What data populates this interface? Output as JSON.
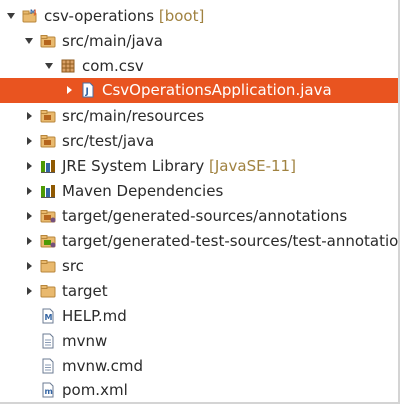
{
  "tree": {
    "project": {
      "label": "csv-operations",
      "decoration": "[boot]",
      "expanded": true
    },
    "src_main_java": {
      "label": "src/main/java",
      "expanded": true
    },
    "package_com_csv": {
      "label": "com.csv",
      "expanded": true
    },
    "main_class": {
      "label": "CsvOperationsApplication.java",
      "selected": true
    },
    "src_main_resources": {
      "label": "src/main/resources"
    },
    "src_test_java": {
      "label": "src/test/java"
    },
    "jre_library": {
      "label": "JRE System Library",
      "decoration": "[JavaSE-11]"
    },
    "maven_deps": {
      "label": "Maven Dependencies"
    },
    "gen_sources": {
      "label": "target/generated-sources/annotations"
    },
    "gen_test_sources": {
      "label": "target/generated-test-sources/test-annotations"
    },
    "src_folder": {
      "label": "src"
    },
    "target_folder": {
      "label": "target"
    },
    "help_md": {
      "label": "HELP.md"
    },
    "mvnw": {
      "label": "mvnw"
    },
    "mvnw_cmd": {
      "label": "mvnw.cmd"
    },
    "pom_xml": {
      "label": "pom.xml"
    }
  },
  "colors": {
    "selection": "#e95420",
    "decoration": "#a08240",
    "folder": "#e9b96e",
    "package": "#b5651d"
  },
  "icons": {
    "project": "maven-project-icon",
    "source_folder": "java-source-folder-icon",
    "package": "java-package-icon",
    "java_file": "java-file-icon",
    "library": "library-icon",
    "folder": "folder-icon",
    "markdown_file": "markdown-file-icon",
    "text_file": "text-file-icon",
    "xml_file": "maven-pom-icon"
  }
}
